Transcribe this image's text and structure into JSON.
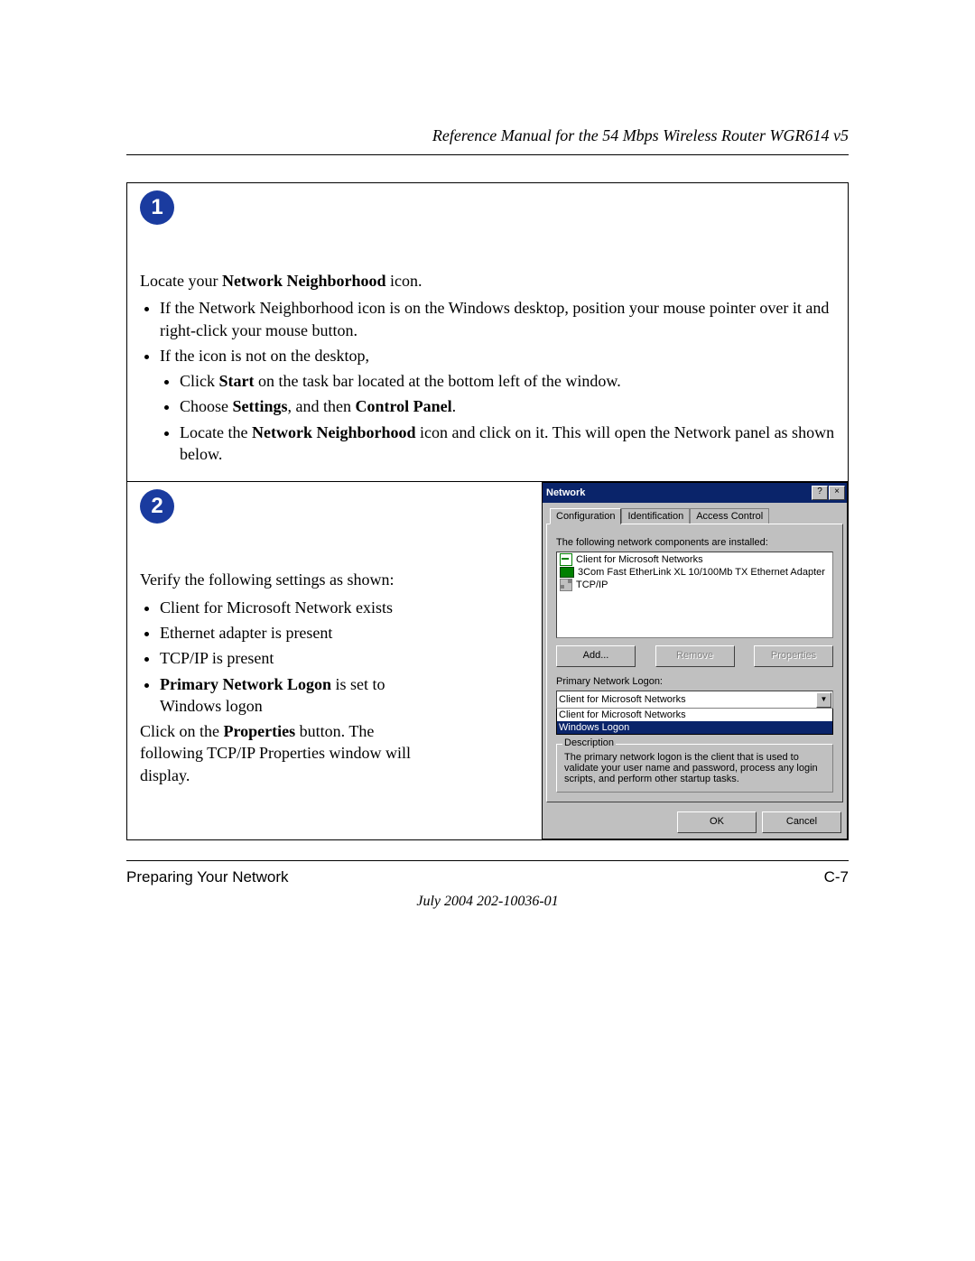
{
  "header_title": "Reference Manual for the 54 Mbps Wireless Router WGR614 v5",
  "step1": {
    "badge": "1",
    "intro_pre": "Locate your ",
    "intro_bold": "Network Neighborhood",
    "intro_post": " icon.",
    "b1": "If the Network Neighborhood icon is on the Windows desktop, position your mouse pointer over it and right-click your mouse button.",
    "b2": "If the icon is not on the desktop,",
    "b2a_pre": "Click ",
    "b2a_bold": "Start",
    "b2a_post": " on the task bar located at the bottom left of the window.",
    "b2b_pre": "Choose ",
    "b2b_bold1": "Settings",
    "b2b_mid": ", and then ",
    "b2b_bold2": "Control Panel",
    "b2b_post": ".",
    "b2c_pre": "Locate the ",
    "b2c_bold": "Network Neighborhood",
    "b2c_post": " icon and click on it. This will open the Network panel as shown below."
  },
  "step2": {
    "badge": "2",
    "p1": "Verify the following settings as shown:",
    "li1": "Client for Microsoft Network exists",
    "li2": "Ethernet adapter is present",
    "li3": "TCP/IP is present",
    "li4_bold": "Primary Network Logon",
    "li4_post": " is set to Windows logon",
    "p2_pre": "Click on the ",
    "p2_bold": "Properties",
    "p2_post": " button. The following TCP/IP Properties window will display."
  },
  "dialog": {
    "title": "Network",
    "help_btn": "?",
    "close_btn": "×",
    "tabs": {
      "t0": "Configuration",
      "t1": "Identification",
      "t2": "Access Control"
    },
    "label_installed": "The following network components are installed:",
    "components": {
      "c0": "Client for Microsoft Networks",
      "c1": "3Com Fast EtherLink XL 10/100Mb TX Ethernet Adapter",
      "c2": "TCP/IP"
    },
    "btn_add": "Add...",
    "btn_remove": "Remove",
    "btn_props": "Properties",
    "label_logon": "Primary Network Logon:",
    "dropdown_value": "Client for Microsoft Networks",
    "opt0": "Client for Microsoft Networks",
    "opt1": "Windows Logon",
    "desc_legend": "Description",
    "desc_text": "The primary network logon is the client that is used to validate your user name and password, process any login scripts, and perform other startup tasks.",
    "ok": "OK",
    "cancel": "Cancel"
  },
  "footer": {
    "left": "Preparing Your Network",
    "right": "C-7",
    "date": "July 2004 202-10036-01"
  }
}
